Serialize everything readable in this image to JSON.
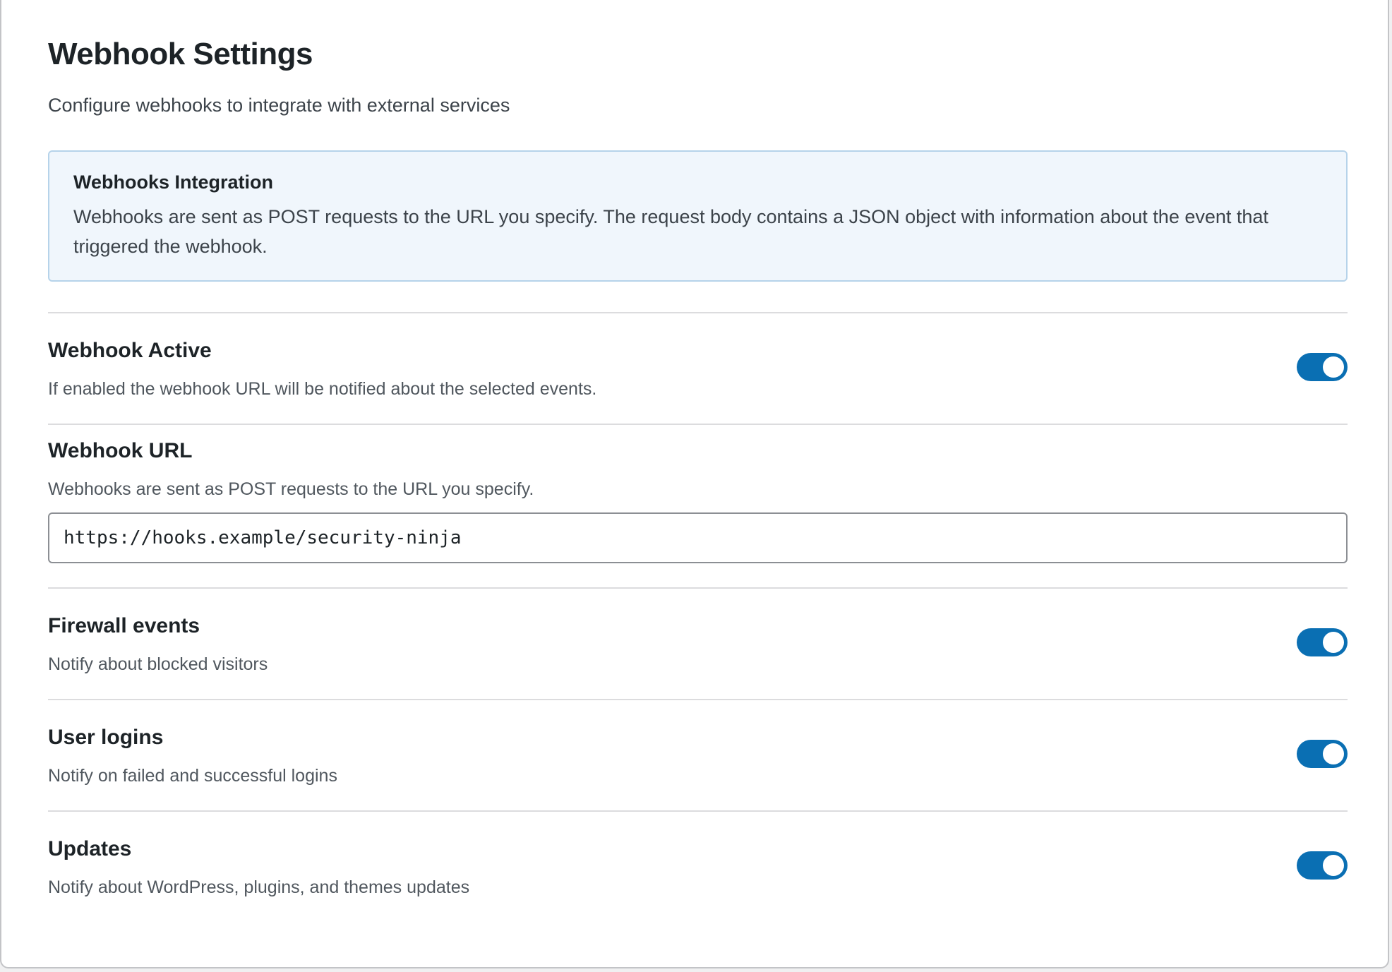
{
  "page": {
    "title": "Webhook Settings",
    "subtitle": "Configure webhooks to integrate with external services"
  },
  "info_box": {
    "title": "Webhooks Integration",
    "text": "Webhooks are sent as POST requests to the URL you specify. The request body contains a JSON object with information about the event that triggered the webhook."
  },
  "settings": {
    "webhook_active": {
      "title": "Webhook Active",
      "description": "If enabled the webhook URL will be notified about the selected events.",
      "enabled": true
    },
    "webhook_url": {
      "title": "Webhook URL",
      "description": "Webhooks are sent as POST requests to the URL you specify.",
      "value": "https://hooks.example/security-ninja"
    },
    "firewall_events": {
      "title": "Firewall events",
      "description": "Notify about blocked visitors",
      "enabled": true
    },
    "user_logins": {
      "title": "User logins",
      "description": "Notify on failed and successful logins",
      "enabled": true
    },
    "updates": {
      "title": "Updates",
      "description": "Notify about WordPress, plugins, and themes updates",
      "enabled": true
    }
  },
  "colors": {
    "toggle_on": "#0a6fb3",
    "info_background": "#f0f6fc",
    "info_border": "#b6d3ea"
  }
}
